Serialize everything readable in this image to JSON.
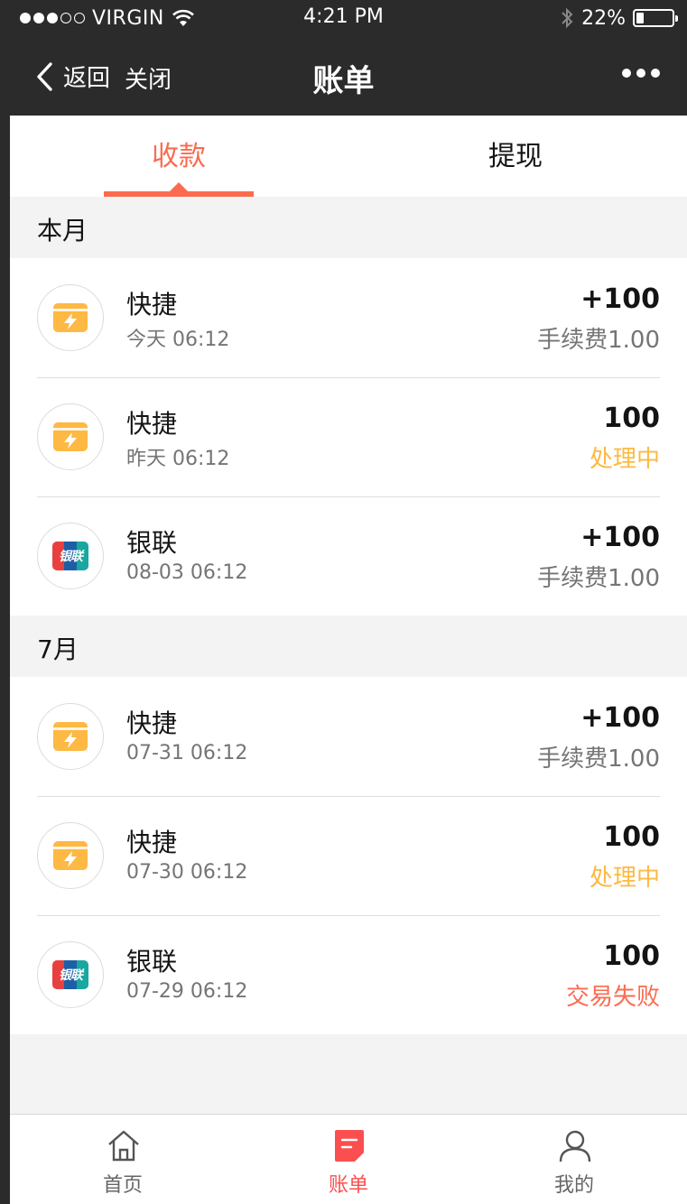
{
  "status_bar": {
    "carrier": "VIRGIN",
    "time": "4:21 PM",
    "battery": "22%",
    "battery_level": 0.22,
    "signal_bars_filled": 3,
    "signal_bars_total": 5
  },
  "nav": {
    "back_label": "返回",
    "close_label": "关闭",
    "title": "账单",
    "more_icon": "more-dots-icon"
  },
  "tabs": {
    "income": "收款",
    "withdraw": "提现",
    "active": "income"
  },
  "sections": [
    {
      "title": "本月",
      "rows": [
        {
          "type": "quick",
          "title": "快捷",
          "date": "今天  06:12",
          "amount": "+100",
          "status": "手续费1.00",
          "status_kind": "fee"
        },
        {
          "type": "quick",
          "title": "快捷",
          "date": "昨天  06:12",
          "amount": "100",
          "status": "处理中",
          "status_kind": "processing"
        },
        {
          "type": "unionpay",
          "title": "银联",
          "date": "08-03  06:12",
          "amount": "+100",
          "status": "手续费1.00",
          "status_kind": "fee"
        }
      ]
    },
    {
      "title": "7月",
      "rows": [
        {
          "type": "quick",
          "title": "快捷",
          "date": "07-31  06:12",
          "amount": "+100",
          "status": "手续费1.00",
          "status_kind": "fee"
        },
        {
          "type": "quick",
          "title": "快捷",
          "date": "07-30  06:12",
          "amount": "100",
          "status": "处理中",
          "status_kind": "processing"
        },
        {
          "type": "unionpay",
          "title": "银联",
          "date": "07-29  06:12",
          "amount": "100",
          "status": "交易失败",
          "status_kind": "failed"
        }
      ]
    }
  ],
  "unionpay_logo_text": "银联",
  "tabbar": {
    "items": [
      {
        "label": "首页",
        "icon": "home-icon",
        "active": false
      },
      {
        "label": "账单",
        "icon": "bill-icon",
        "active": true
      },
      {
        "label": "我的",
        "icon": "profile-icon",
        "active": false
      }
    ]
  },
  "colors": {
    "accent": "#fb6b4f",
    "text_primary": "#141414",
    "text_secondary": "#757575",
    "processing": "#fdb943",
    "background": "#f3f3f3",
    "quick_icon": "#fdb943"
  }
}
